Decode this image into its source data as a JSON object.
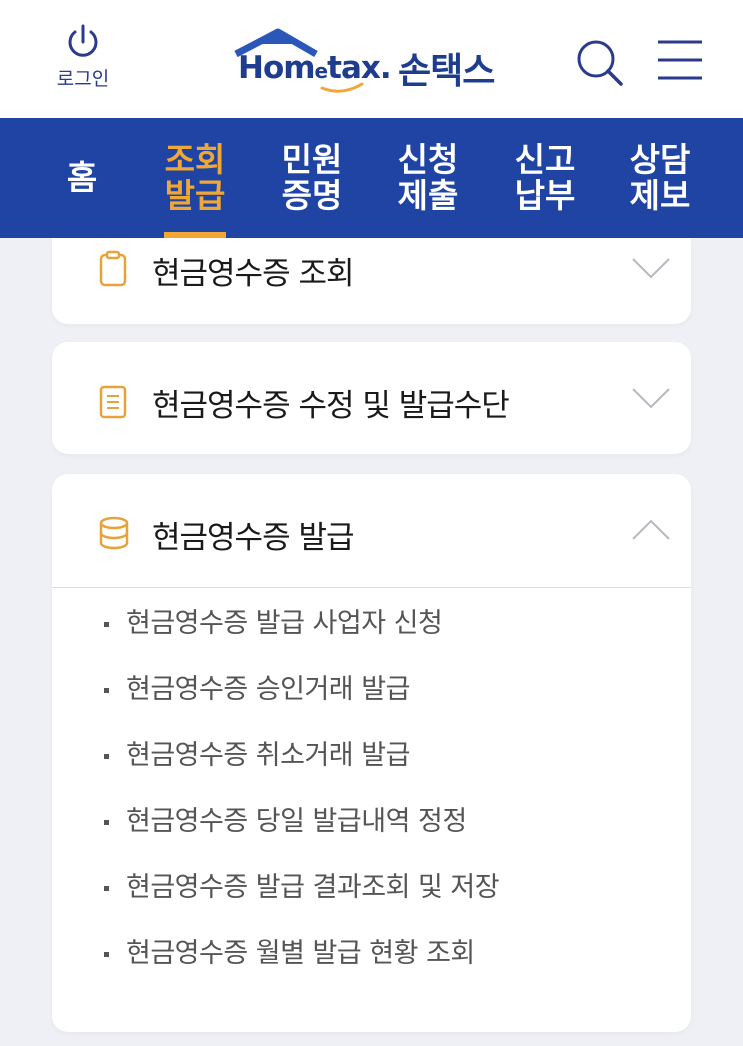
{
  "header": {
    "login_label": "로그인",
    "logo_wordmark_a": "Hom",
    "logo_wordmark_e": "e",
    "logo_wordmark_b": "tax.",
    "logo_kr": "손택스",
    "colors": {
      "brand_blue": "#1f3d8f",
      "logo_roof": "#2b58b8",
      "logo_swoosh": "#f0a733"
    }
  },
  "nav": {
    "items": [
      {
        "label": "홈",
        "active": false
      },
      {
        "label": "조회\n발급",
        "active": true
      },
      {
        "label": "민원\n증명",
        "active": false
      },
      {
        "label": "신청\n제출",
        "active": false
      },
      {
        "label": "신고\n납부",
        "active": false
      },
      {
        "label": "상담\n제보",
        "active": false
      }
    ],
    "colors": {
      "background": "#1f44a3",
      "active": "#f0a733",
      "text": "#ffffff"
    }
  },
  "sections": [
    {
      "title": "현금영수증 조회",
      "icon": "clipboard-icon",
      "expanded": false
    },
    {
      "title": "현금영수증 수정 및 발급수단",
      "icon": "document-icon",
      "expanded": false
    },
    {
      "title": "현금영수증 발급",
      "icon": "database-icon",
      "expanded": true,
      "items": [
        "현금영수증 발급 사업자 신청",
        "현금영수증 승인거래 발급",
        "현금영수증 취소거래 발급",
        "현금영수증 당일 발급내역 정정",
        "현금영수증 발급 결과조회 및 저장",
        "현금영수증 월별 발급 현황 조회"
      ]
    }
  ],
  "icon_color": "#e8a23a"
}
